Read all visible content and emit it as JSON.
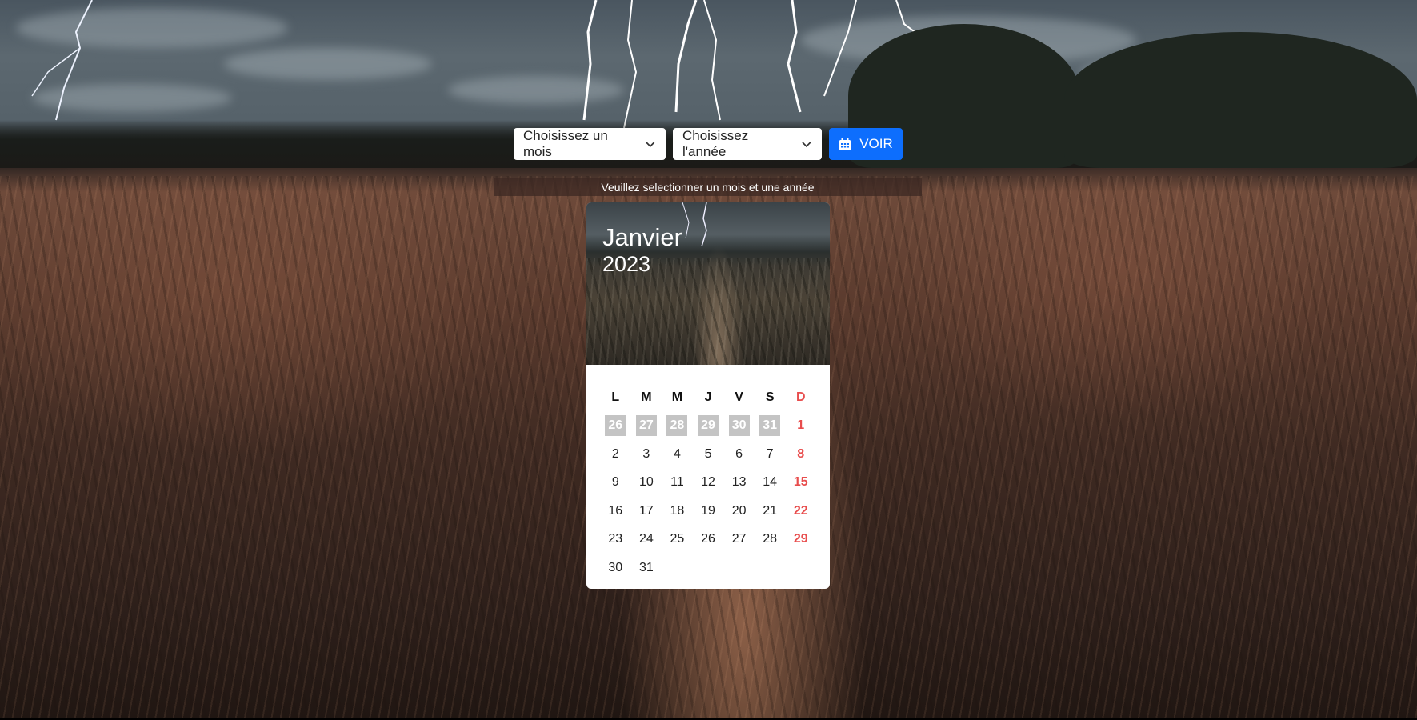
{
  "controls": {
    "month_placeholder": "Choisissez un mois",
    "year_placeholder": "Choisissez l'année",
    "voir_label": "VOIR",
    "voir_icon": "calendar-icon",
    "accent_color": "#0d6efd"
  },
  "message": "Veuillez selectionner un mois et une année",
  "calendar": {
    "month": "Janvier",
    "year": "2023",
    "sunday_color": "#e84d4d",
    "weekdays": [
      "L",
      "M",
      "M",
      "J",
      "V",
      "S",
      "D"
    ],
    "weeks": [
      [
        "26",
        "27",
        "28",
        "29",
        "30",
        "31",
        "1"
      ],
      [
        "2",
        "3",
        "4",
        "5",
        "6",
        "7",
        "8"
      ],
      [
        "9",
        "10",
        "11",
        "12",
        "13",
        "14",
        "15"
      ],
      [
        "16",
        "17",
        "18",
        "19",
        "20",
        "21",
        "22"
      ],
      [
        "23",
        "24",
        "25",
        "26",
        "27",
        "28",
        "29"
      ],
      [
        "30",
        "31",
        "",
        "",
        "",
        "",
        ""
      ]
    ]
  }
}
